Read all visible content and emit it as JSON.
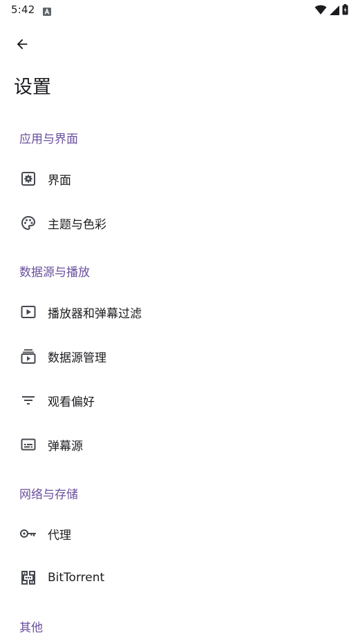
{
  "status_bar": {
    "time": "5:42",
    "notification_icon": "a-notification-icon",
    "wifi_icon": "wifi-icon",
    "signal_icon": "signal-icon",
    "battery_icon": "battery-charging-icon"
  },
  "header": {
    "back_icon": "arrow-back-icon",
    "title": "设置"
  },
  "sections": [
    {
      "header": "应用与界面",
      "items": [
        {
          "label": "界面",
          "icon": "settings-box-icon"
        },
        {
          "label": "主题与色彩",
          "icon": "palette-icon"
        }
      ]
    },
    {
      "header": "数据源与播放",
      "items": [
        {
          "label": "播放器和弹幕过滤",
          "icon": "play-box-icon"
        },
        {
          "label": "数据源管理",
          "icon": "subscriptions-icon"
        },
        {
          "label": "观看偏好",
          "icon": "filter-list-icon"
        },
        {
          "label": "弹幕源",
          "icon": "subtitles-icon"
        }
      ]
    },
    {
      "header": "网络与存储",
      "items": [
        {
          "label": "代理",
          "icon": "key-icon"
        },
        {
          "label": "BitTorrent",
          "icon": "dns-icon"
        }
      ]
    },
    {
      "header": "其他",
      "items": []
    }
  ],
  "colors": {
    "accent": "#6a4f9e",
    "text": "#1c1b1f",
    "icon": "#44474e",
    "background": "#ffffff"
  }
}
